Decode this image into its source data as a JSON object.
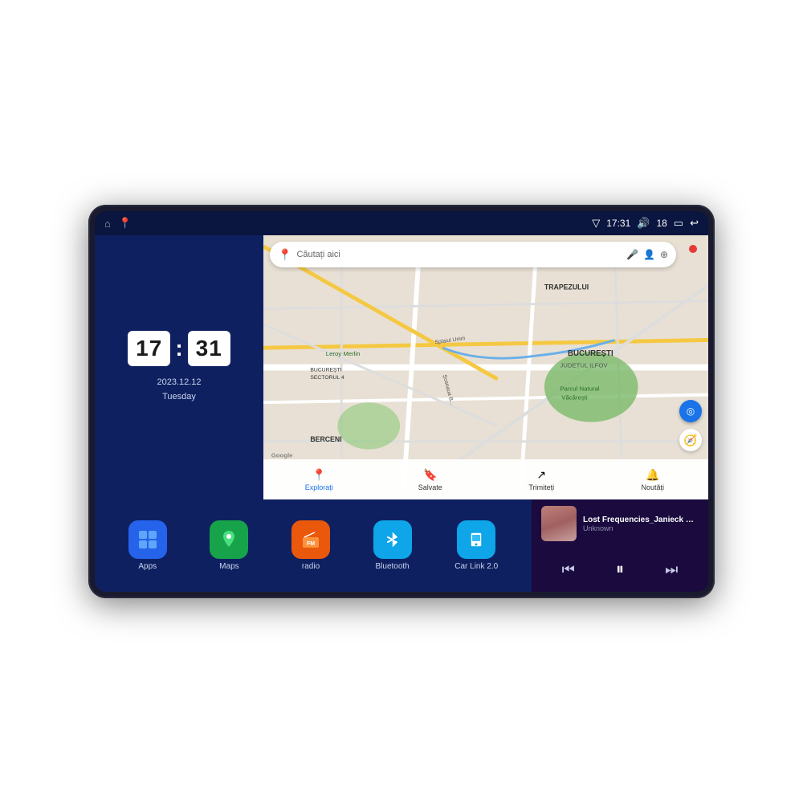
{
  "device": {
    "screen": {
      "status_bar": {
        "left_icons": [
          "home",
          "maps"
        ],
        "signal_icon": "▽",
        "time": "17:31",
        "volume_icon": "🔊",
        "volume_level": "18",
        "battery_icon": "🔋",
        "back_icon": "↩"
      },
      "clock_panel": {
        "hours": "17",
        "minutes": "31",
        "date": "2023.12.12",
        "day": "Tuesday"
      },
      "map_panel": {
        "search_placeholder": "Căutați aici",
        "labels": [
          "TRAPEZULUI",
          "BUCUREȘTI",
          "JUDEȚUL ILFOV",
          "BERCENI",
          "Parcul Natural Văcărești",
          "Leroy Merlin",
          "BUCUREȘTI\nSECTORUL 4",
          "Splaiul Unirii",
          "Șoseaua B..."
        ],
        "bottom_nav": [
          {
            "label": "Explorați",
            "icon": "📍",
            "active": true
          },
          {
            "label": "Salvate",
            "icon": "🔖",
            "active": false
          },
          {
            "label": "Trimiteți",
            "icon": "↗",
            "active": false
          },
          {
            "label": "Noutăți",
            "icon": "🔔",
            "active": false
          }
        ],
        "google_label": "Google"
      },
      "apps": [
        {
          "id": "apps",
          "label": "Apps",
          "icon": "⊞",
          "color": "#2563eb"
        },
        {
          "id": "maps",
          "label": "Maps",
          "icon": "📍",
          "color": "#16a34a"
        },
        {
          "id": "radio",
          "label": "radio",
          "icon": "📻",
          "color": "#ea580c"
        },
        {
          "id": "bluetooth",
          "label": "Bluetooth",
          "icon": "₿",
          "color": "#0ea5e9"
        },
        {
          "id": "carlink",
          "label": "Car Link 2.0",
          "icon": "📱",
          "color": "#0ea5e9"
        }
      ],
      "music_player": {
        "title": "Lost Frequencies_Janieck Devy-...",
        "artist": "Unknown",
        "controls": {
          "prev": "⏮",
          "play": "⏸",
          "next": "⏭"
        }
      }
    }
  }
}
